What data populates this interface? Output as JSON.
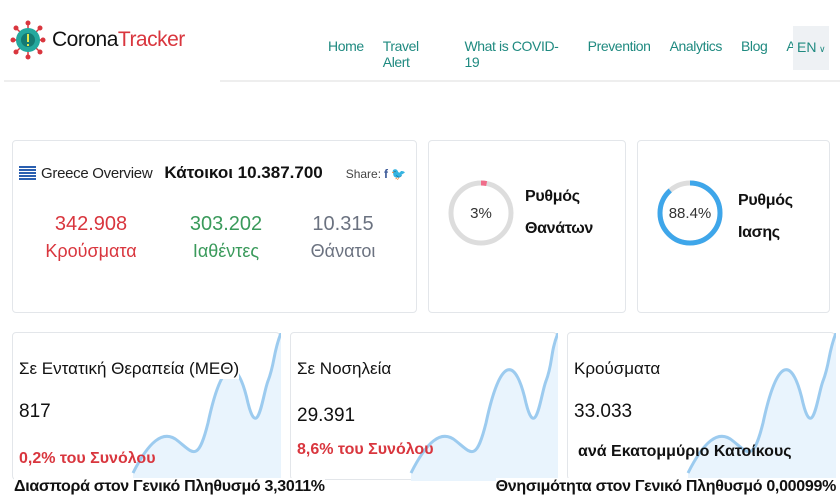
{
  "nav": {
    "brand_1": "Corona",
    "brand_2": "Tracker",
    "items": [
      "Home",
      "Travel Alert",
      "What is COVID-19",
      "Prevention",
      "Analytics",
      "Blog",
      "About"
    ],
    "lang": "EN"
  },
  "overview": {
    "title": "Greece Overview",
    "population": "Κάτοικοι 10.387.700",
    "share": "Share:",
    "stats": [
      {
        "value": "342.908",
        "label": "Κρούσματα",
        "color": "#d9363e"
      },
      {
        "value": "303.202",
        "label": "Ιαθέντες",
        "color": "#3a9a5b"
      },
      {
        "value": "10.315",
        "label": "Θάνατοι",
        "color": "#6b7280"
      }
    ]
  },
  "gauges": [
    {
      "value": "3%",
      "fraction": 0.03,
      "label_1": "Ρυθμός",
      "label_2": "Θανάτων",
      "color": "#f06d8a"
    },
    {
      "value": "88.4%",
      "fraction": 0.884,
      "label_1": "Ρυθμός",
      "label_2": "Ιασης",
      "color": "#3ea6ea"
    }
  ],
  "cards": [
    {
      "title": "Σε Εντατική Θεραπεία (ΜΕΘ)",
      "value": "817",
      "sub": "0,2% του Συνόλου"
    },
    {
      "title": "Σε Νοσηλεία",
      "value": "29.391",
      "sub": "8,6% του Συνόλου"
    },
    {
      "title": "Κρούσματα",
      "value": "33.033",
      "sub": "ανά Εκατομμύριο Κατοίκους"
    }
  ],
  "footer": {
    "left": "Διασπορά στον Γενικό Πληθυσμό  3,3011%",
    "right": "Θνησιμότητα στον Γενικό Πληθυσμό  0,00099%"
  }
}
